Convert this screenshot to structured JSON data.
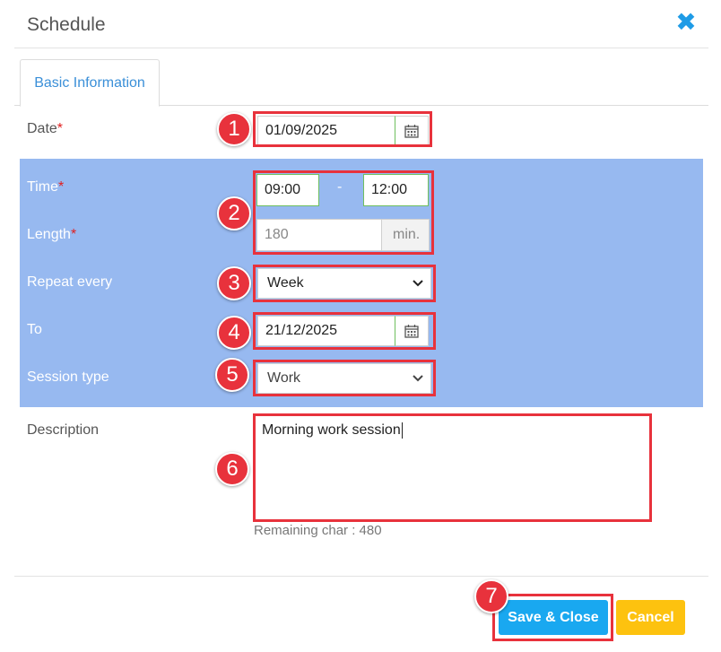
{
  "dialog": {
    "title": "Schedule",
    "close_icon": "close-x-icon"
  },
  "tabs": [
    {
      "label": "Basic Information"
    }
  ],
  "form": {
    "date": {
      "label": "Date",
      "required_mark": "*",
      "value": "01/09/2025"
    },
    "time": {
      "label": "Time",
      "required_mark": "*",
      "start": "09:00",
      "separator": "-",
      "end": "12:00"
    },
    "length": {
      "label": "Length",
      "required_mark": "*",
      "value": "180",
      "unit": "min."
    },
    "repeat": {
      "label": "Repeat every",
      "value": "Week"
    },
    "to": {
      "label": "To",
      "value": "21/12/2025"
    },
    "session_type": {
      "label": "Session type",
      "value": "Work"
    },
    "description": {
      "label": "Description",
      "value": "Morning work session",
      "remaining": "Remaining char : 480"
    }
  },
  "annotations": [
    "1",
    "2",
    "3",
    "4",
    "5",
    "6",
    "7"
  ],
  "buttons": {
    "save": "Save & Close",
    "cancel": "Cancel"
  },
  "colors": {
    "accent_blue": "#19a8f0",
    "highlight_bg": "#97b9f0",
    "annotation_red": "#e8323c",
    "cancel_yellow": "#fdc20f"
  }
}
